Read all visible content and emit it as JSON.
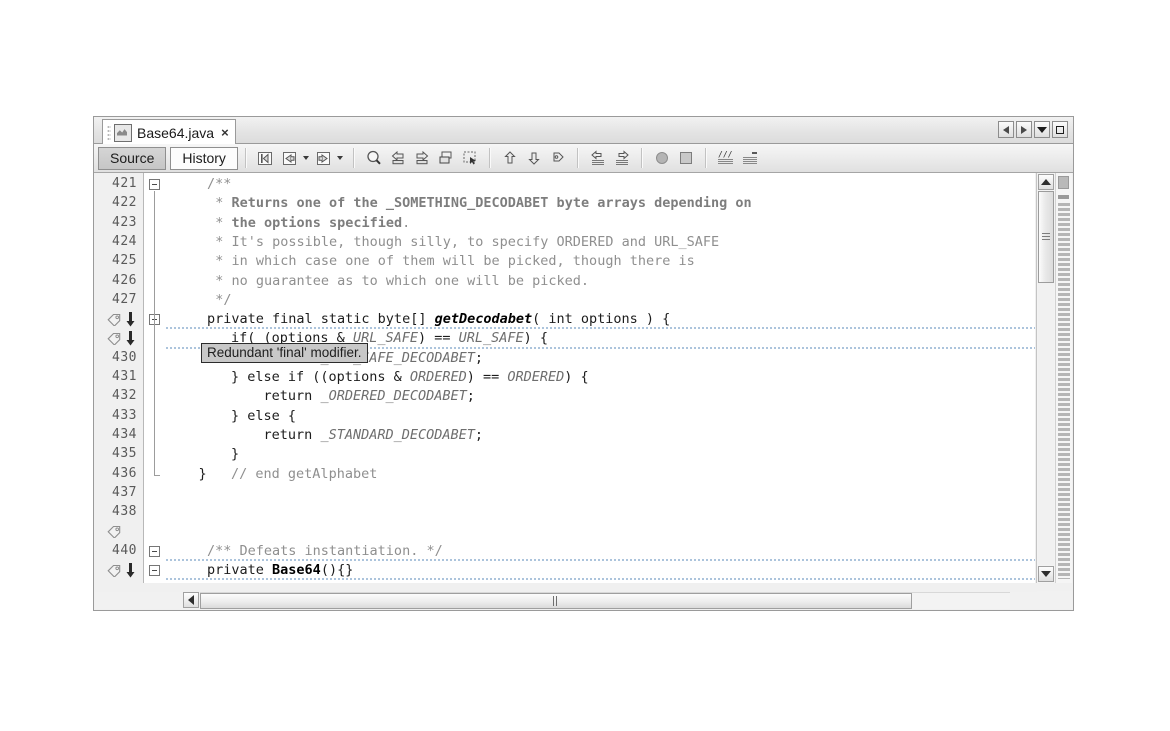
{
  "window": {
    "tab": {
      "label": "Base64.java",
      "close_label": "×",
      "icon": "java-file-icon"
    },
    "controls": [
      {
        "name": "scroll-tabs-left-button",
        "icon": "triangle-left-icon"
      },
      {
        "name": "scroll-tabs-right-button",
        "icon": "triangle-right-icon"
      },
      {
        "name": "tab-list-dropdown-button",
        "icon": "chevron-down-icon"
      },
      {
        "name": "maximize-window-button",
        "icon": "square-icon"
      }
    ]
  },
  "view_tabs": [
    {
      "label": "Source",
      "selected": true
    },
    {
      "label": "History",
      "selected": false
    }
  ],
  "toolbar": {
    "buttons": [
      {
        "name": "last-edit-button",
        "icon": "last-edit-icon",
        "dropdown": false
      },
      {
        "name": "back-button",
        "icon": "navigate-back-icon",
        "dropdown": true
      },
      {
        "name": "forward-button",
        "icon": "navigate-forward-icon",
        "dropdown": true
      },
      {
        "name": "find-selection-button",
        "icon": "find-magnifier-icon",
        "dropdown": false
      },
      {
        "name": "previous-bookmark-button",
        "icon": "arrow-left-bookmark-icon",
        "dropdown": false
      },
      {
        "name": "next-bookmark-button",
        "icon": "arrow-right-bookmark-icon",
        "dropdown": false
      },
      {
        "name": "toggle-bookmark-button",
        "icon": "toggle-bookmark-icon",
        "dropdown": false
      },
      {
        "name": "toggle-rectangular-selection-button",
        "icon": "rectangular-selection-icon",
        "dropdown": false
      },
      {
        "name": "previous-error-button",
        "icon": "arrow-up-error-icon",
        "dropdown": false
      },
      {
        "name": "next-error-button",
        "icon": "arrow-down-error-icon",
        "dropdown": false
      },
      {
        "name": "next-annotation-button",
        "icon": "annotation-arrow-icon",
        "dropdown": false
      },
      {
        "name": "shift-line-left-button",
        "icon": "shift-left-icon",
        "dropdown": false
      },
      {
        "name": "shift-line-right-button",
        "icon": "shift-right-icon",
        "dropdown": false
      },
      {
        "name": "toggle-breakpoint-button",
        "icon": "breakpoint-circle-icon",
        "dropdown": false
      },
      {
        "name": "stop-button",
        "icon": "stop-square-icon",
        "dropdown": false
      },
      {
        "name": "comment-button",
        "icon": "comment-lines-icon",
        "dropdown": false
      },
      {
        "name": "uncomment-button",
        "icon": "uncomment-lines-icon",
        "dropdown": false
      }
    ]
  },
  "tooltip": {
    "text": "Redundant 'final' modifier."
  },
  "editor": {
    "lines": [
      {
        "num": "421",
        "indent": 5,
        "fold": "open",
        "segments": [
          {
            "t": "/**",
            "c": "cmt"
          }
        ]
      },
      {
        "num": "422",
        "indent": 6,
        "segments": [
          {
            "t": "* ",
            "c": "cmt"
          },
          {
            "t": "Returns one of the _SOMETHING_DECODABET byte arrays depending on",
            "c": "cmtb"
          }
        ]
      },
      {
        "num": "423",
        "indent": 6,
        "segments": [
          {
            "t": "* ",
            "c": "cmt"
          },
          {
            "t": "the options specified",
            "c": "cmtb"
          },
          {
            "t": ".",
            "c": "cmt"
          }
        ]
      },
      {
        "num": "424",
        "indent": 6,
        "segments": [
          {
            "t": "* It's possible, though silly, to specify ORDERED and URL_SAFE",
            "c": "cmt"
          }
        ]
      },
      {
        "num": "425",
        "indent": 6,
        "segments": [
          {
            "t": "* in which case one of them will be picked, though there is",
            "c": "cmt"
          }
        ]
      },
      {
        "num": "426",
        "indent": 6,
        "segments": [
          {
            "t": "* no guarantee as to which one will be picked.",
            "c": "cmt"
          }
        ]
      },
      {
        "num": "427",
        "indent": 6,
        "segments": [
          {
            "t": "*/",
            "c": "cmt"
          }
        ]
      },
      {
        "num": "",
        "indent": 5,
        "fold": "open",
        "annotation": true,
        "hint": true,
        "segments": [
          {
            "t": "private final static byte[] ",
            "c": "kw"
          },
          {
            "t": "getDecodabet",
            "c": "mname"
          },
          {
            "t": "( int options ) {",
            "c": "kw"
          }
        ]
      },
      {
        "num": "",
        "indent": 0,
        "annotation": true,
        "hint": true,
        "segments": [
          {
            "t": "        if( (options & ",
            "c": "kw"
          },
          {
            "t": "URL_SAFE",
            "c": "fld"
          },
          {
            "t": ") == ",
            "c": "kw"
          },
          {
            "t": "URL_SAFE",
            "c": "fld"
          },
          {
            "t": ") {",
            "c": "kw"
          }
        ]
      },
      {
        "num": "430",
        "indent": 0,
        "segments": [
          {
            "t": "            return ",
            "c": "kw"
          },
          {
            "t": "_URL_SAFE_DECODABET",
            "c": "fld"
          },
          {
            "t": ";",
            "c": "kw"
          }
        ]
      },
      {
        "num": "431",
        "indent": 0,
        "segments": [
          {
            "t": "        } else if ((options & ",
            "c": "kw"
          },
          {
            "t": "ORDERED",
            "c": "fld"
          },
          {
            "t": ") == ",
            "c": "kw"
          },
          {
            "t": "ORDERED",
            "c": "fld"
          },
          {
            "t": ") {",
            "c": "kw"
          }
        ]
      },
      {
        "num": "432",
        "indent": 0,
        "segments": [
          {
            "t": "            return ",
            "c": "kw"
          },
          {
            "t": "_ORDERED_DECODABET",
            "c": "fld"
          },
          {
            "t": ";",
            "c": "kw"
          }
        ]
      },
      {
        "num": "433",
        "indent": 0,
        "segments": [
          {
            "t": "        } else {",
            "c": "kw"
          }
        ]
      },
      {
        "num": "434",
        "indent": 0,
        "segments": [
          {
            "t": "            return ",
            "c": "kw"
          },
          {
            "t": "_STANDARD_DECODABET",
            "c": "fld"
          },
          {
            "t": ";",
            "c": "kw"
          }
        ]
      },
      {
        "num": "435",
        "indent": 0,
        "segments": [
          {
            "t": "        }",
            "c": "kw"
          }
        ]
      },
      {
        "num": "436",
        "indent": 0,
        "fold": "end",
        "segments": [
          {
            "t": "    }   ",
            "c": "kw"
          },
          {
            "t": "// end getAlphabet",
            "c": "cmt"
          }
        ]
      },
      {
        "num": "437",
        "indent": 0,
        "segments": []
      },
      {
        "num": "438",
        "indent": 0,
        "segments": []
      },
      {
        "num": "",
        "indent": 0,
        "annotation": true,
        "segments": []
      },
      {
        "num": "440",
        "indent": 5,
        "fold": "open",
        "hint": true,
        "segments": [
          {
            "t": "/** Defeats instantiation. */",
            "c": "cmt"
          }
        ]
      },
      {
        "num": "",
        "indent": 5,
        "fold": "open",
        "annotation": true,
        "hint": true,
        "segments": [
          {
            "t": "private ",
            "c": "kw"
          },
          {
            "t": "Base64",
            "c": "bold"
          },
          {
            "t": "(){}",
            "c": "kw"
          }
        ]
      },
      {
        "num": "",
        "indent": 0,
        "annotation": true,
        "segments": []
      }
    ]
  },
  "scrollbars": {
    "vertical": {
      "up_icon": "triangle-up-icon",
      "down_icon": "triangle-down-icon"
    },
    "horizontal": {
      "left_icon": "triangle-left-icon",
      "right_icon": "triangle-right-icon"
    }
  }
}
